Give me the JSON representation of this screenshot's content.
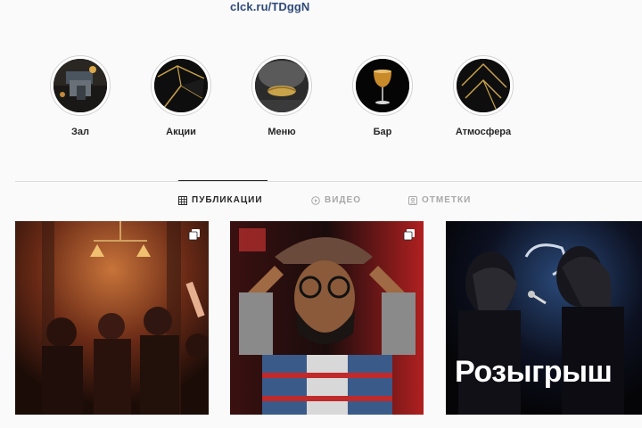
{
  "profile": {
    "bio_link": "clck.ru/TDggN"
  },
  "highlights": [
    {
      "label": "Зал",
      "icon": "hall-thumbnail"
    },
    {
      "label": "Акции",
      "icon": "gold-lines-thumbnail"
    },
    {
      "label": "Меню",
      "icon": "gold-lips-thumbnail"
    },
    {
      "label": "Бар",
      "icon": "cocktail-glass-thumbnail"
    },
    {
      "label": "Атмосфера",
      "icon": "gold-lines-thumbnail"
    }
  ],
  "tabs": [
    {
      "label": "ПУБЛИКАЦИИ",
      "icon": "grid-icon",
      "active": true
    },
    {
      "label": "ВИДЕО",
      "icon": "reels-icon",
      "active": false
    },
    {
      "label": "ОТМЕТКИ",
      "icon": "tagged-icon",
      "active": false
    }
  ],
  "posts": [
    {
      "type": "carousel",
      "icon": "carousel-icon"
    },
    {
      "type": "carousel",
      "icon": "carousel-icon"
    },
    {
      "type": "image",
      "overlay_text": "Розыгрыш"
    }
  ],
  "colors": {
    "link": "#2f4a7a",
    "active_tab": "#262626",
    "inactive_tab": "#a8a8a8",
    "gold": "#c9a24a"
  }
}
